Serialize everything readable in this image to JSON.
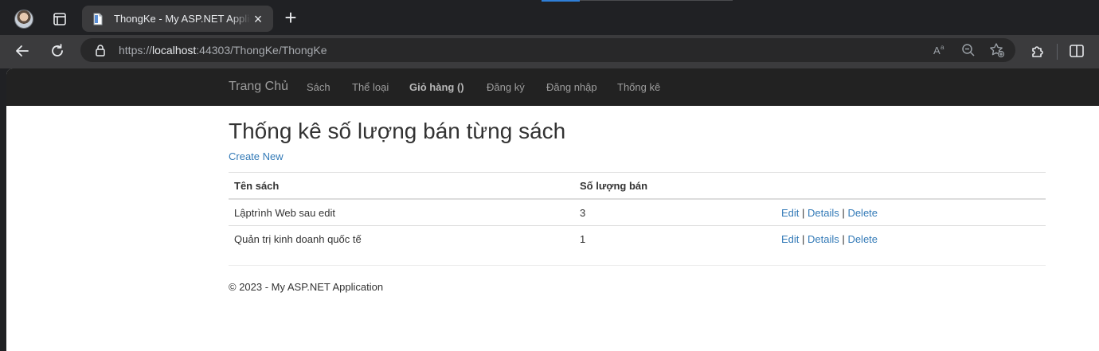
{
  "browser": {
    "tab_title": "ThongKe - My ASP.NET Application",
    "new_tab_symbol": "+",
    "close_symbol": "×",
    "url_scheme": "https://",
    "url_host": "localhost",
    "url_rest": ":44303/ThongKe/ThongKe",
    "icons": [
      "profile-avatar",
      "tab-actions-icon",
      "back-icon",
      "refresh-icon",
      "lock-icon",
      "read-aloud-icon",
      "zoom-out-icon",
      "favorite-icon",
      "extensions-icon",
      "split-screen-icon"
    ]
  },
  "navbar": {
    "brand": "Trang Chủ",
    "links": [
      "Sách",
      "Thể loại",
      "Giỏ hàng ()",
      "Đăng ký",
      "Đăng nhập",
      "Thống kê"
    ]
  },
  "page": {
    "title": "Thống kê số lượng bán từng sách",
    "create_label": "Create New",
    "table": {
      "headers": [
        "Tên sách",
        "Số lượng bán"
      ],
      "rows": [
        {
          "name": "Lậptrình Web sau edit",
          "qty": "3"
        },
        {
          "name": "Quản trị kinh doanh quốc tế",
          "qty": "1"
        }
      ],
      "actions": {
        "edit": "Edit",
        "details": "Details",
        "delete": "Delete",
        "separator": "|"
      }
    },
    "footer": "© 2023 - My ASP.NET Application"
  },
  "colors": {
    "navbar_bg": "#222222",
    "link": "#337ab7",
    "text": "#333333"
  }
}
